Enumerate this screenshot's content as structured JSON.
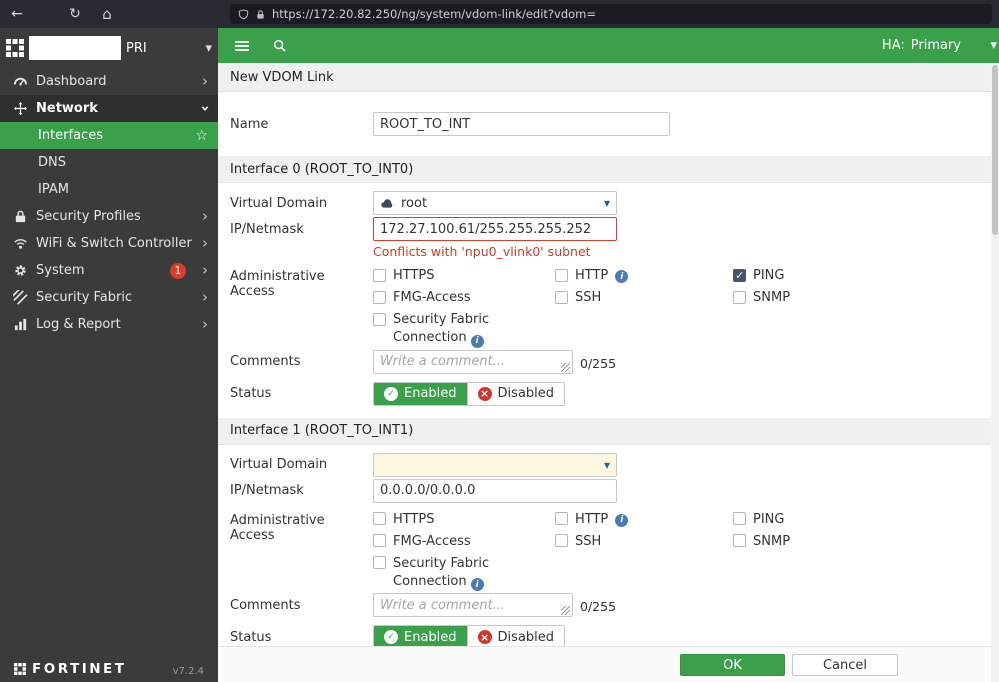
{
  "colors": {
    "accent": "#3ba04a",
    "error": "#cf3b2a",
    "badge": "#dd3b2b",
    "caret_blue": "#2a5d9c",
    "checked": "#4a5568"
  },
  "icons": {
    "back": "←",
    "refresh": "↻",
    "home": "⌂",
    "menu": "hamburger-bars",
    "search": "magnifier",
    "shield": "shield-outline",
    "lock": "padlock",
    "dropdown_caret": "▾",
    "chevron_right": "›",
    "star": "☆",
    "info": "i",
    "enabled_check": "✓",
    "disabled_x": "×"
  },
  "browser": {
    "url": "https://172.20.82.250/ng/system/vdom-link/edit?vdom="
  },
  "sidebar": {
    "brand_suffix": "PRI",
    "items": [
      {
        "label": "Dashboard"
      },
      {
        "label": "Network"
      },
      {
        "label": "Interfaces"
      },
      {
        "label": "DNS"
      },
      {
        "label": "IPAM"
      },
      {
        "label": "Security Profiles"
      },
      {
        "label": "WiFi & Switch Controller"
      },
      {
        "label": "System",
        "badge": "1"
      },
      {
        "label": "Security Fabric"
      },
      {
        "label": "Log & Report"
      }
    ],
    "footer_brand": "FORTINET",
    "footer_version": "v7.2.4"
  },
  "topbar": {
    "ha_label": "HA:",
    "ha_value": "Primary"
  },
  "page": {
    "title": "New VDOM Link"
  },
  "form": {
    "name_label": "Name",
    "name_value": "ROOT_TO_INT",
    "sections": [
      {
        "title": "Interface 0 (ROOT_TO_INT0)",
        "vd_label": "Virtual Domain",
        "vd_value": "root",
        "ip_label": "IP/Netmask",
        "ip_value": "172.27.100.61/255.255.255.252",
        "error": "Conflicts with 'npu0_vlink0' subnet",
        "admin_label": "Administrative Access",
        "admin": {
          "https": {
            "label": "HTTPS",
            "checked": false
          },
          "fmg": {
            "label": "FMG-Access",
            "checked": false
          },
          "fabric": {
            "label": "Security Fabric Connection",
            "checked": false
          },
          "http": {
            "label": "HTTP",
            "checked": false
          },
          "ssh": {
            "label": "SSH",
            "checked": false
          },
          "ping": {
            "label": "PING",
            "checked": true
          },
          "snmp": {
            "label": "SNMP",
            "checked": false
          }
        },
        "comments_label": "Comments",
        "comments_placeholder": "Write a comment...",
        "comments_counter": "0/255",
        "status_label": "Status",
        "status_enabled": "Enabled",
        "status_disabled": "Disabled",
        "status_value": "Enabled"
      },
      {
        "title": "Interface 1 (ROOT_TO_INT1)",
        "vd_label": "Virtual Domain",
        "vd_value": "",
        "ip_label": "IP/Netmask",
        "ip_value": "0.0.0.0/0.0.0.0",
        "error": "",
        "admin_label": "Administrative Access",
        "admin": {
          "https": {
            "label": "HTTPS",
            "checked": false
          },
          "fmg": {
            "label": "FMG-Access",
            "checked": false
          },
          "fabric": {
            "label": "Security Fabric Connection",
            "checked": false
          },
          "http": {
            "label": "HTTP",
            "checked": false
          },
          "ssh": {
            "label": "SSH",
            "checked": false
          },
          "ping": {
            "label": "PING",
            "checked": false
          },
          "snmp": {
            "label": "SNMP",
            "checked": false
          }
        },
        "comments_label": "Comments",
        "comments_placeholder": "Write a comment...",
        "comments_counter": "0/255",
        "status_label": "Status",
        "status_enabled": "Enabled",
        "status_disabled": "Disabled",
        "status_value": "Enabled"
      }
    ]
  },
  "footer": {
    "ok_label": "OK",
    "cancel_label": "Cancel"
  }
}
